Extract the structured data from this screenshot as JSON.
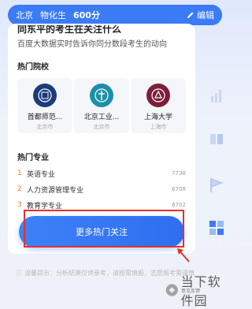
{
  "topbar": {
    "region": "北京",
    "subjects": "物化生",
    "score": "600分",
    "edit_label": "编辑"
  },
  "card": {
    "heading": "同东平的考生在关注什么",
    "subtitle": "百度大数据实时告诉你同分数段考生的动向",
    "schools_title": "热门院校",
    "schools": [
      {
        "name": "首都师范...",
        "city": "北京市"
      },
      {
        "name": "北京工业...",
        "city": "北京市"
      },
      {
        "name": "上海大学",
        "city": "上海市"
      }
    ],
    "majors_title": "热门专业",
    "majors": [
      {
        "rank": "1",
        "name": "英语专业",
        "count": "7738"
      },
      {
        "rank": "2",
        "name": "人力资源管理专业",
        "count": "6708"
      },
      {
        "rank": "3",
        "name": "教育学专业",
        "count": "6702"
      }
    ],
    "more_button": "更多热门关注"
  },
  "disclaimer": {
    "text": "温馨提示：分析结果仅供参考，请按需填报，志愿报考需谨慎"
  },
  "watermark": {
    "brand": "当下软件园",
    "sub": "意见反馈"
  },
  "colors": {
    "primary": "#3b7bf5",
    "highlight_box": "#e0322f",
    "rank_orange": "#e87b2b"
  }
}
